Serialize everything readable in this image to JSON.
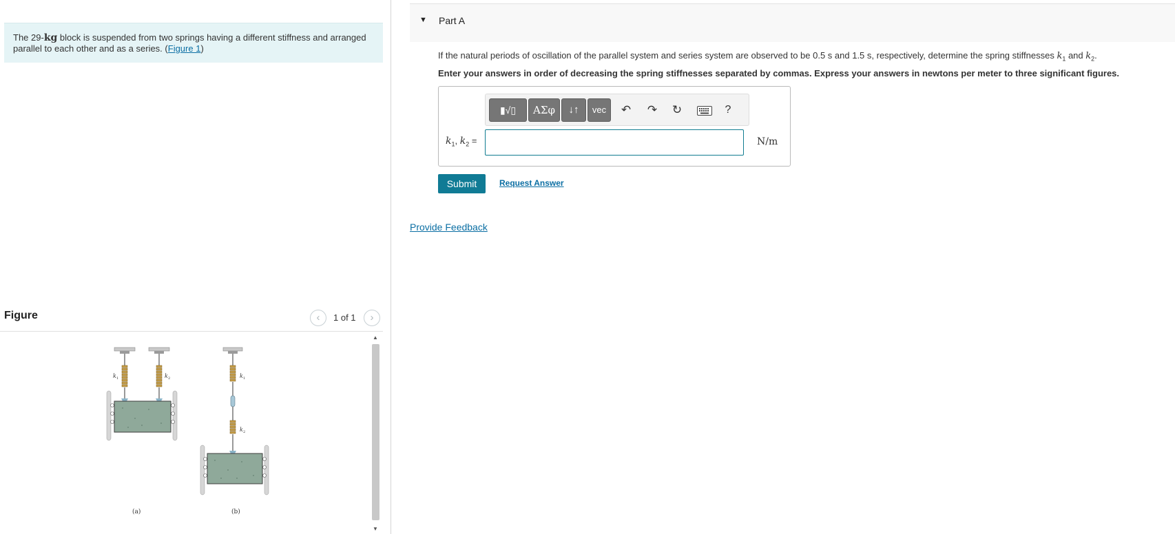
{
  "problem": {
    "text_before": "The 29-",
    "mass_unit": "kg",
    "text_after": " block is suspended from two springs having a different stiffness and arranged parallel to each other and as a series. (",
    "figure_link": "Figure 1",
    "text_close": ")"
  },
  "figure": {
    "title": "Figure",
    "pager": "1 of 1",
    "prev_icon": "chevron-left-icon",
    "next_icon": "chevron-right-icon",
    "label_k1": "k",
    "label_k2": "k",
    "sub1": "1",
    "sub2": "2",
    "label_a": "(a)",
    "label_b": "(b)"
  },
  "part": {
    "title": "Part A",
    "question_before": "If the natural periods of oscillation of the parallel system and series system are observed to be 0.5 s and 1.5 s, respectively, determine the spring stiffnesses ",
    "question_mid": " and ",
    "question_end": ".",
    "var_k": "k",
    "sub1": "1",
    "sub2": "2",
    "instructions": "Enter your answers in order of decreasing the spring stiffnesses separated by commas. Express your answers in newtons per meter to three significant figures."
  },
  "toolbar": {
    "template_label": "▮√▯",
    "greek_label": "ΑΣφ",
    "updown_label": "↓↑",
    "vec_label": "vec",
    "undo_icon": "↶",
    "redo_icon": "↷",
    "reset_icon": "↻",
    "help_label": "?"
  },
  "answer": {
    "label_var": "k",
    "label_sep": ", ",
    "label_eq": " =",
    "sub1": "1",
    "sub2": "2",
    "value": "",
    "unit": "N/m"
  },
  "actions": {
    "submit_label": "Submit",
    "request_answer_label": "Request Answer",
    "feedback_label": "Provide Feedback"
  },
  "colors": {
    "accent": "#107b95",
    "link": "#0a6ea3",
    "problem_bg": "#e5f4f6",
    "block": "#8fa99a"
  }
}
